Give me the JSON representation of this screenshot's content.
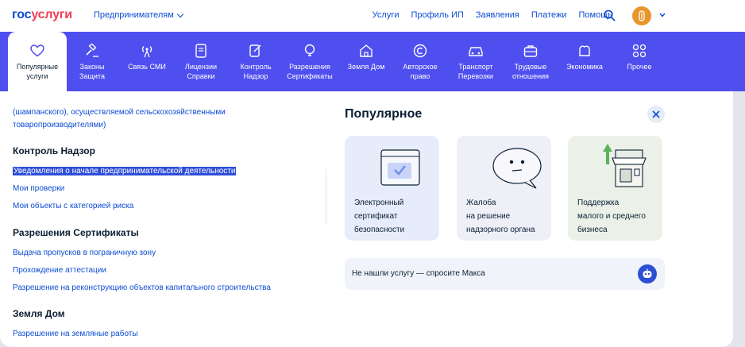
{
  "header": {
    "logo_part1": "гос",
    "logo_part2": "услуги",
    "segment": "Предпринимателям",
    "nav": [
      "Услуги",
      "Профиль ИП",
      "Заявления",
      "Платежи",
      "Помощь"
    ]
  },
  "categories": [
    {
      "label": "Популярные\nуслуги",
      "icon": "heart-icon",
      "active": true
    },
    {
      "label": "Законы\nЗащита",
      "icon": "gavel-icon"
    },
    {
      "label": "Связь СМИ",
      "icon": "antenna-icon"
    },
    {
      "label": "Лицензии\nСправки",
      "icon": "document-icon"
    },
    {
      "label": "Контроль\nНадзор",
      "icon": "check-doc-icon"
    },
    {
      "label": "Разрешения\nСертификаты",
      "icon": "bulb-icon"
    },
    {
      "label": "Земля Дом",
      "icon": "house-icon"
    },
    {
      "label": "Авторское\nправо",
      "icon": "copyright-icon"
    },
    {
      "label": "Транспорт\nПеревозки",
      "icon": "car-icon"
    },
    {
      "label": "Трудовые\nотношения",
      "icon": "briefcase-icon"
    },
    {
      "label": "Экономика",
      "icon": "wallet-icon"
    },
    {
      "label": "Прочее",
      "icon": "grid-icon"
    }
  ],
  "list": {
    "cont_line1": "(шампанского), осуществляемой сельскохозяйственными",
    "cont_line2": "товаропроизводителями)",
    "control": {
      "title": "Контроль Надзор",
      "items": [
        "Уведомления о начале предпринимательской деятельности",
        "Мои проверки",
        "Мои объекты с категорией риска"
      ]
    },
    "permits": {
      "title": "Разрешения Сертификаты",
      "items": [
        "Выдача пропусков в пограничную зону",
        "Прохождение аттестации",
        "Разрешение на реконструкцию объектов капитального строительства"
      ]
    },
    "land": {
      "title": "Земля Дом",
      "items": [
        "Разрешение на земляные работы"
      ]
    }
  },
  "popular": {
    "title": "Популярное",
    "cards": [
      {
        "label": "Электронный\nсертификат\nбезопасности",
        "icon": "certificate-icon"
      },
      {
        "label": "Жалоба\nна решение\nнадзорного органа",
        "icon": "speech-bubble-icon"
      },
      {
        "label": "Поддержка\nмалого и среднего\nбизнеса",
        "icon": "shop-icon"
      }
    ],
    "ask_text": "Не нашли услугу — спросите Макса"
  },
  "colors": {
    "accent": "#4f4ff0",
    "link": "#0d4cd3",
    "logo_red": "#ee3f58",
    "avatar": "#e7962b"
  }
}
